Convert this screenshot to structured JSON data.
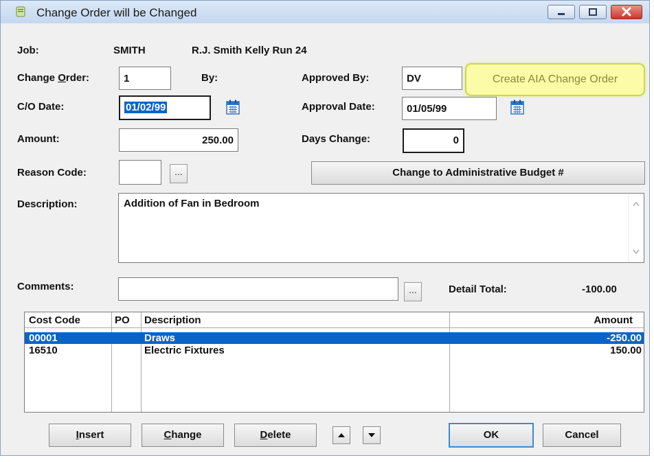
{
  "window": {
    "title": "Change Order will be Changed"
  },
  "header": {
    "job_label": "Job:",
    "job_code": "SMITH",
    "job_name": "R.J. Smith Kelly Run 24"
  },
  "form": {
    "change_order_label_pre": "Change ",
    "change_order_label_key": "O",
    "change_order_label_post": "rder:",
    "change_order_value": "1",
    "by_label": "By:",
    "approved_by_label": "Approved By:",
    "approved_by_value": "DV",
    "co_date_label": "C/O Date:",
    "co_date_value": "01/02/99",
    "approval_date_label": "Approval Date:",
    "approval_date_value": "01/05/99",
    "amount_label": "Amount:",
    "amount_value": "250.00",
    "days_change_label": "Days Change:",
    "days_change_value": "0",
    "reason_code_label": "Reason Code:",
    "reason_code_value": "",
    "description_label": "Description:",
    "description_value": "Addition of Fan in Bedroom",
    "comments_label": "Comments:",
    "comments_value": "",
    "detail_total_label": "Detail Total:",
    "detail_total_value": "-100.00",
    "ellipsis": "..."
  },
  "buttons": {
    "create_aia": "Create AIA Change Order",
    "change_budget": "Change to Administrative Budget #",
    "insert": {
      "key": "I",
      "rest": "nsert"
    },
    "change": {
      "key": "C",
      "rest": "hange"
    },
    "delete": {
      "key": "D",
      "rest": "elete"
    },
    "ok": "OK",
    "cancel": "Cancel"
  },
  "grid": {
    "columns": [
      "Cost Code",
      "PO",
      "Description",
      "Amount"
    ],
    "rows": [
      {
        "cost_code": "00001",
        "po": "",
        "description": "Draws",
        "amount": "-250.00",
        "selected": true
      },
      {
        "cost_code": "16510",
        "po": "",
        "description": "Electric Fixtures",
        "amount": "150.00",
        "selected": false
      }
    ]
  },
  "icons": {
    "app": "document-icon",
    "calendar": "calendar-icon",
    "minimize": "minimize-icon",
    "maximize": "maximize-icon",
    "close": "close-icon",
    "up": "arrow-up-icon",
    "down": "arrow-down-icon"
  },
  "colors": {
    "selection": "#0a64c8",
    "close_button": "#d9483b",
    "aia_highlight": "#fcfca8"
  }
}
